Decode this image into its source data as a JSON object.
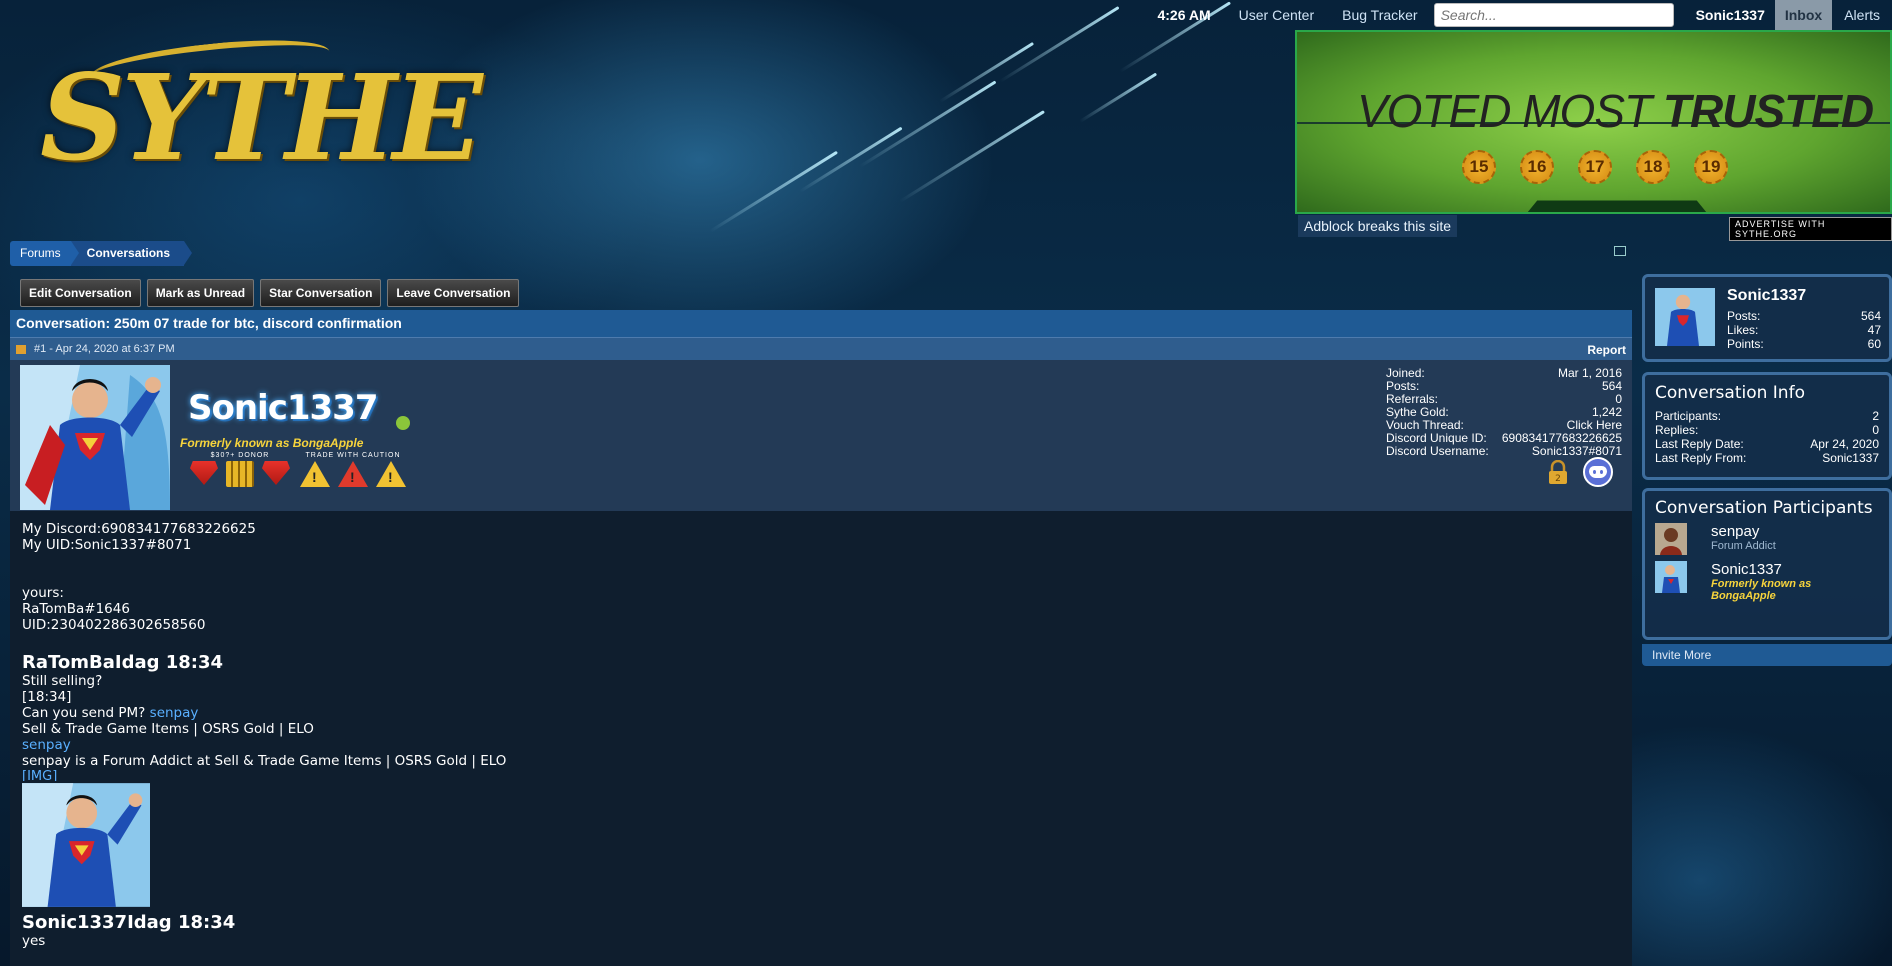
{
  "topbar": {
    "time": "4:26 AM",
    "user_center": "User Center",
    "bug_tracker": "Bug Tracker",
    "search_placeholder": "Search...",
    "username": "Sonic1337",
    "inbox": "Inbox",
    "alerts": "Alerts"
  },
  "logo": {
    "text": "SYTHE"
  },
  "banner": {
    "headline_light": "VOTED MOST ",
    "headline_bold": "TRUSTED",
    "years": [
      "15",
      "16",
      "17",
      "18",
      "19"
    ],
    "adblock": "Adblock breaks this site",
    "advertise": "ADVERTISE WITH SYTHE.ORG"
  },
  "breadcrumb": {
    "forums": "Forums",
    "conversations": "Conversations"
  },
  "actions": {
    "edit": "Edit Conversation",
    "unread": "Mark as Unread",
    "star": "Star Conversation",
    "leave": "Leave Conversation"
  },
  "conversation": {
    "title": "Conversation: 250m 07 trade for btc, discord confirmation",
    "post_number": "#1 - Apr 24, 2020 at 6:37 PM",
    "report": "Report"
  },
  "poster": {
    "signature_name": "Sonic1337",
    "formerly": "Formerly known as BongaApple",
    "badge_caption_1": "$30?+ DONOR",
    "badge_caption_2": "TRADE WITH CAUTION",
    "stats": [
      {
        "label": "Joined:",
        "value": "Mar 1, 2016"
      },
      {
        "label": "Posts:",
        "value": "564"
      },
      {
        "label": "Referrals:",
        "value": "0"
      },
      {
        "label": "Sythe Gold:",
        "value": "1,242"
      },
      {
        "label": "Vouch Thread:",
        "value": "Click Here"
      },
      {
        "label": "Discord Unique ID:",
        "value": "690834177683226625"
      },
      {
        "label": "Discord Username:",
        "value": "Sonic1337#8071"
      }
    ]
  },
  "message": {
    "l1": "My Discord:690834177683226625",
    "l2": "My UID:Sonic1337#8071",
    "l3": "yours:",
    "l4": "RaTomBa#1646",
    "l5": "UID:230402286302658560",
    "h1": "RaTomBaIdag 18:34",
    "l6": "Still selling?",
    "l7": "[18:34]",
    "l8_text": "Can you send PM? ",
    "l8_link": "senpay",
    "l9": "Sell & Trade Game Items | OSRS Gold | ELO",
    "l10_link": "senpay",
    "l11": "senpay is a Forum Addict at Sell & Trade Game Items | OSRS Gold | ELO",
    "img_alt": "[IMG]",
    "h2": "Sonic1337Idag 18:34",
    "l12": "yes"
  },
  "sidebar": {
    "user": {
      "name": "Sonic1337",
      "stats": [
        {
          "label": "Posts:",
          "value": "564"
        },
        {
          "label": "Likes:",
          "value": "47"
        },
        {
          "label": "Points:",
          "value": "60"
        }
      ]
    },
    "info": {
      "title": "Conversation Info",
      "rows": [
        {
          "label": "Participants:",
          "value": "2"
        },
        {
          "label": "Replies:",
          "value": "0"
        },
        {
          "label": "Last Reply Date:",
          "value": "Apr 24, 2020"
        },
        {
          "label": "Last Reply From:",
          "value": "Sonic1337"
        }
      ]
    },
    "participants": {
      "title": "Conversation Participants",
      "list": [
        {
          "name": "senpay",
          "title": "Forum Addict"
        },
        {
          "name": "Sonic1337",
          "title": "Formerly known as BongaApple"
        }
      ]
    },
    "invite": "Invite More"
  }
}
